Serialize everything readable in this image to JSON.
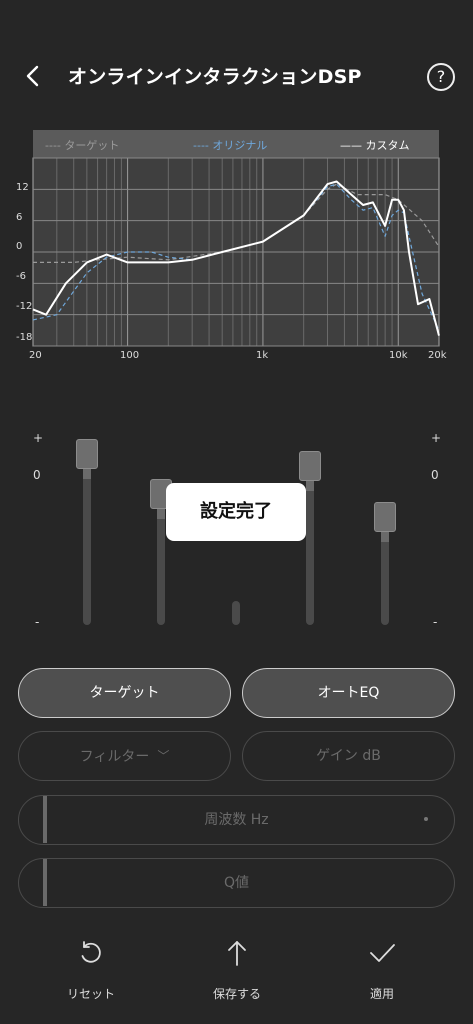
{
  "header": {
    "title": "オンラインインタラクションDSP"
  },
  "legend": {
    "target": "---- ターゲット",
    "original": "---- オリジナル",
    "custom": "—— カスタム"
  },
  "chart_data": {
    "type": "line",
    "title": "",
    "xlabel": "",
    "ylabel": "",
    "x_scale": "log",
    "xlim": [
      20,
      20000
    ],
    "ylim": [
      -18,
      18
    ],
    "x_ticks": [
      "20",
      "100",
      "1k",
      "10k",
      "20k"
    ],
    "y_ticks": [
      "12",
      "6",
      "0",
      "-6",
      "-12",
      "-18"
    ],
    "grid": true,
    "legend_position": "top",
    "series": [
      {
        "name": "ターゲット",
        "style": "dashed",
        "color": "#9a9a9a",
        "x": [
          20,
          40,
          60,
          100,
          200,
          500,
          1000,
          2000,
          3000,
          3500,
          5000,
          8000,
          10000,
          15000,
          20000
        ],
        "y": [
          -2,
          -2,
          -1.5,
          -1,
          -1.5,
          0,
          2,
          7,
          12,
          13,
          11,
          11,
          10,
          6,
          1
        ]
      },
      {
        "name": "オリジナル",
        "style": "dashed",
        "color": "#6fa8dc",
        "x": [
          20,
          30,
          50,
          70,
          100,
          150,
          200,
          300,
          500,
          1000,
          2000,
          3000,
          3500,
          4500,
          5500,
          6500,
          8000,
          9000,
          10000,
          11000,
          12000,
          15000,
          20000
        ],
        "y": [
          -13,
          -12,
          -4,
          -1,
          0,
          0,
          -1,
          -1.5,
          0,
          2,
          7,
          12.5,
          13,
          10,
          8,
          8.5,
          3,
          7,
          8,
          7.5,
          3,
          -8,
          -15
        ]
      },
      {
        "name": "カスタム",
        "style": "solid",
        "color": "#ffffff",
        "x": [
          20,
          25,
          35,
          50,
          70,
          100,
          150,
          200,
          300,
          500,
          1000,
          2000,
          3000,
          3500,
          4500,
          5500,
          6500,
          8000,
          9000,
          10000,
          11000,
          12000,
          14000,
          17000,
          20000
        ],
        "y": [
          -11,
          -12,
          -6,
          -2,
          -0.5,
          -2,
          -2,
          -2,
          -1.5,
          0,
          2,
          7,
          13,
          13.5,
          11,
          9,
          9.5,
          5,
          10,
          10,
          8,
          0,
          -10,
          -9,
          -16
        ]
      }
    ]
  },
  "eq": {
    "plus": "+",
    "zero": "0",
    "minus": "-",
    "sliders": [
      {
        "id": "band1",
        "level": 0.92
      },
      {
        "id": "band2",
        "level": 0.68
      },
      {
        "id": "band3",
        "level": 0.0
      },
      {
        "id": "band4",
        "level": 0.85
      },
      {
        "id": "band5",
        "level": 0.55
      }
    ]
  },
  "toast": {
    "text": "設定完了"
  },
  "buttons": {
    "target": "ターゲット",
    "auto_eq": "オートEQ",
    "filter": "フィルター",
    "gain": "ゲイン dB",
    "frequency": "周波数 Hz",
    "q": "Q値"
  },
  "bottom": {
    "reset": "リセット",
    "save": "保存する",
    "apply": "適用"
  }
}
